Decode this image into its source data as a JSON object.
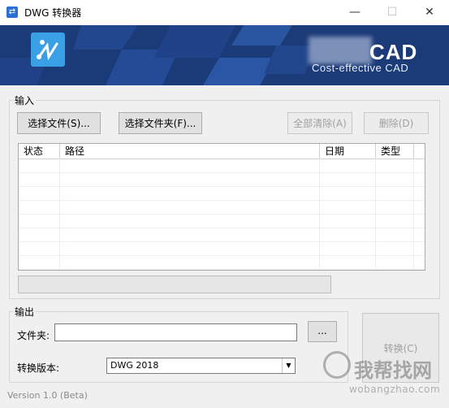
{
  "window": {
    "title": "DWG 转换器",
    "app_icon": "⇄",
    "minimize": "—",
    "maximize": "☐",
    "close": "✕"
  },
  "banner": {
    "brand": "CAD",
    "tagline": "Cost-effective CAD"
  },
  "input": {
    "legend": "输入",
    "select_files": "选择文件(S)...",
    "select_folder": "选择文件夹(F)...",
    "clear_all": "全部清除(A)",
    "delete": "删除(D)",
    "columns": {
      "status": "状态",
      "path": "路径",
      "date": "日期",
      "type": "类型"
    }
  },
  "output": {
    "legend": "输出",
    "folder_label": "文件夹:",
    "folder_value": "",
    "browse": "...",
    "version_label": "转换版本:",
    "version_value": "DWG 2018"
  },
  "convert_button": "转换(C)",
  "version_text": "Version 1.0 (Beta)",
  "watermark": {
    "main": "我帮找网",
    "sub": "wobangzhao.com"
  },
  "colors": {
    "banner": "#1b3a78",
    "accent": "#2b6fd6"
  }
}
